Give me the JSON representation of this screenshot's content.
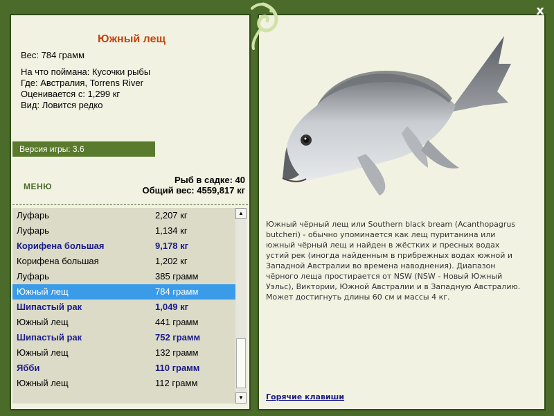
{
  "close_label": "x",
  "fish": {
    "title": "Южный лещ",
    "weight": "Вес: 784 грамм",
    "bait": "На что поймана: Кусочки рыбы",
    "location": "Где: Австралия, Torrens River",
    "estimate": "Оценивается с: 1,299 кг",
    "kind": "Вид: Ловится редко"
  },
  "version": "Версия игры: 3.6",
  "menu_label": "МЕНЮ",
  "stats": {
    "fish_count": "Рыб в садке: 40",
    "total_weight": "Общий вес: 4559,817 кг"
  },
  "catch_list": [
    {
      "name": "Луфарь",
      "weight": "2,207 кг",
      "bold": false,
      "selected": false
    },
    {
      "name": "Луфарь",
      "weight": "1,134 кг",
      "bold": false,
      "selected": false
    },
    {
      "name": "Корифена большая",
      "weight": "9,178 кг",
      "bold": true,
      "selected": false
    },
    {
      "name": "Корифена большая",
      "weight": "1,202 кг",
      "bold": false,
      "selected": false
    },
    {
      "name": "Луфарь",
      "weight": "385 грамм",
      "bold": false,
      "selected": false
    },
    {
      "name": "Южный лещ",
      "weight": "784 грамм",
      "bold": false,
      "selected": true
    },
    {
      "name": "Шипастый рак",
      "weight": "1,049 кг",
      "bold": true,
      "selected": false
    },
    {
      "name": "Южный лещ",
      "weight": "441 грамм",
      "bold": false,
      "selected": false
    },
    {
      "name": "Шипастый рак",
      "weight": "752 грамм",
      "bold": true,
      "selected": false
    },
    {
      "name": "Южный лещ",
      "weight": "132 грамм",
      "bold": false,
      "selected": false
    },
    {
      "name": "Ябби",
      "weight": "110 грамм",
      "bold": true,
      "selected": false
    },
    {
      "name": "Южный лещ",
      "weight": "112 грамм",
      "bold": false,
      "selected": false
    }
  ],
  "description": "Южный чёрный лещ или Southern black bream (Acanthopagrus butcheri) - обычно упоминается как лещ пуританина или южный чёрный лещ и найден в жёстких и пресных водах устий рек (иногда найденным в прибрежных водах южной и Западной Австралии во времена наводнения). Диапазон чёрного леща простирается от NSW (NSW - Новый Южный Уэльс), Виктории, Южной Австралии и в Западную Австралию. Может достигнуть длины 60 см и массы 4 кг.",
  "hotkeys_label": "Горячие клавиши",
  "icons": {
    "logo": "leaf-fish-logo-icon",
    "close": "close-icon",
    "scroll_up": "arrow-up-icon",
    "scroll_down": "arrow-down-icon"
  },
  "colors": {
    "background": "#4a6b2a",
    "panel": "#f2f2e2",
    "title": "#c0440e",
    "selected": "#3a9be8",
    "bold_text": "#1a1a8a"
  }
}
